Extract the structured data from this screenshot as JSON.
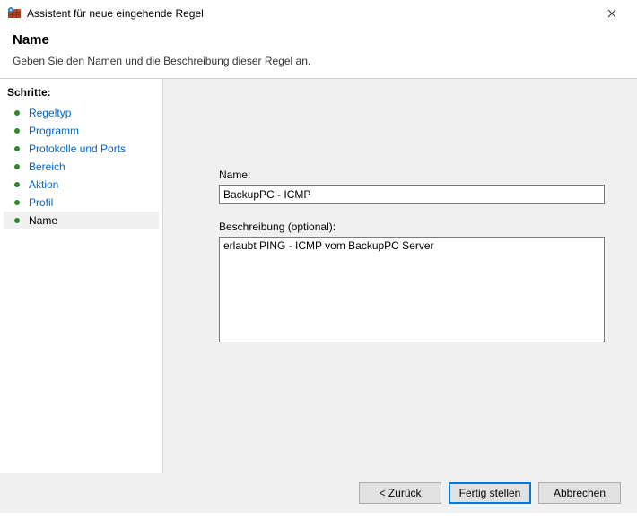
{
  "window": {
    "title": "Assistent für neue eingehende Regel"
  },
  "header": {
    "title": "Name",
    "subtitle": "Geben Sie den Namen und die Beschreibung dieser Regel an."
  },
  "sidebar": {
    "steps_title": "Schritte:",
    "steps": [
      {
        "label": "Regeltyp"
      },
      {
        "label": "Programm"
      },
      {
        "label": "Protokolle und Ports"
      },
      {
        "label": "Bereich"
      },
      {
        "label": "Aktion"
      },
      {
        "label": "Profil"
      },
      {
        "label": "Name"
      }
    ]
  },
  "form": {
    "name_label": "Name:",
    "name_value": "BackupPC - ICMP",
    "desc_label": "Beschreibung (optional):",
    "desc_value": "erlaubt PING - ICMP vom BackupPC Server"
  },
  "footer": {
    "back": "< Zurück",
    "finish": "Fertig stellen",
    "cancel": "Abbrechen"
  }
}
